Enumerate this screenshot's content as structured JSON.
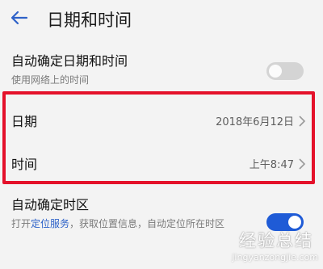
{
  "header": {
    "title": "日期和时间"
  },
  "auto_datetime": {
    "title": "自动确定日期和时间",
    "subtitle": "使用网络上的时间",
    "enabled": false
  },
  "date_row": {
    "label": "日期",
    "value": "2018年6月12日"
  },
  "time_row": {
    "label": "时间",
    "value": "上午8:47"
  },
  "auto_timezone": {
    "title": "自动确定时区",
    "sub_prefix": "打开",
    "sub_link": "定位服务",
    "sub_suffix": "，获取位置信息，自动定位所在时区",
    "enabled": true
  },
  "watermark": {
    "logo": "经验总结",
    "url": "jingyanzongjie.com"
  },
  "colors": {
    "highlight": "#e4112a",
    "accent": "#1f5bd6",
    "link": "#2d62c9"
  },
  "icons": {
    "back": "arrow-left-icon",
    "chevron": "chevron-right-icon"
  }
}
